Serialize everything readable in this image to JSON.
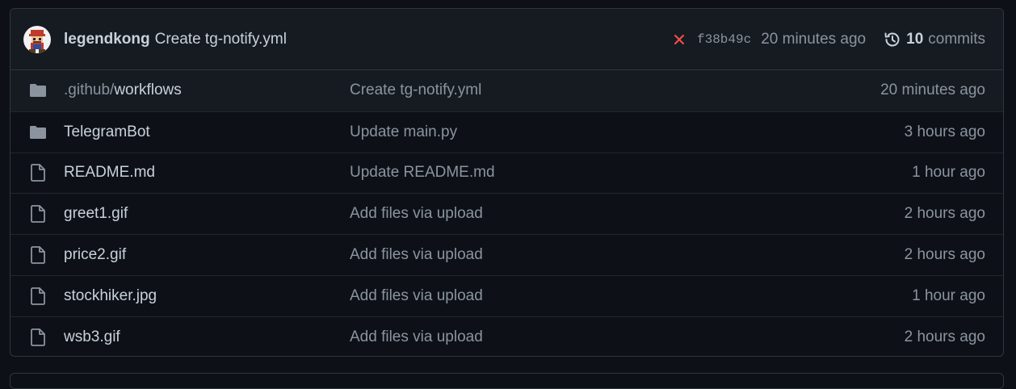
{
  "latest_commit": {
    "author": "legendkong",
    "message": "Create tg-notify.yml",
    "status_icon": "x-icon",
    "status_color": "#f85149",
    "sha": "f38b49c",
    "time": "20 minutes ago",
    "history_icon": "history-icon",
    "commit_count": "10",
    "commit_label": "commits"
  },
  "files": [
    {
      "type": "folder",
      "icon": "folder-icon",
      "name_prefix": ".github/",
      "name": "workflows",
      "message": "Create tg-notify.yml",
      "time": "20 minutes ago"
    },
    {
      "type": "folder",
      "icon": "folder-icon",
      "name_prefix": "",
      "name": "TelegramBot",
      "message": "Update main.py",
      "time": "3 hours ago"
    },
    {
      "type": "file",
      "icon": "file-icon",
      "name_prefix": "",
      "name": "README.md",
      "message": "Update README.md",
      "time": "1 hour ago"
    },
    {
      "type": "file",
      "icon": "file-icon",
      "name_prefix": "",
      "name": "greet1.gif",
      "message": "Add files via upload",
      "time": "2 hours ago"
    },
    {
      "type": "file",
      "icon": "file-icon",
      "name_prefix": "",
      "name": "price2.gif",
      "message": "Add files via upload",
      "time": "2 hours ago"
    },
    {
      "type": "file",
      "icon": "file-icon",
      "name_prefix": "",
      "name": "stockhiker.jpg",
      "message": "Add files via upload",
      "time": "1 hour ago"
    },
    {
      "type": "file",
      "icon": "file-icon",
      "name_prefix": "",
      "name": "wsb3.gif",
      "message": "Add files via upload",
      "time": "2 hours ago"
    }
  ],
  "colors": {
    "background": "#0d1117",
    "header_bg": "#161b22",
    "border": "#30363d",
    "text": "#c9d1d9",
    "muted": "#8b949e",
    "icon": "#8b949e"
  }
}
